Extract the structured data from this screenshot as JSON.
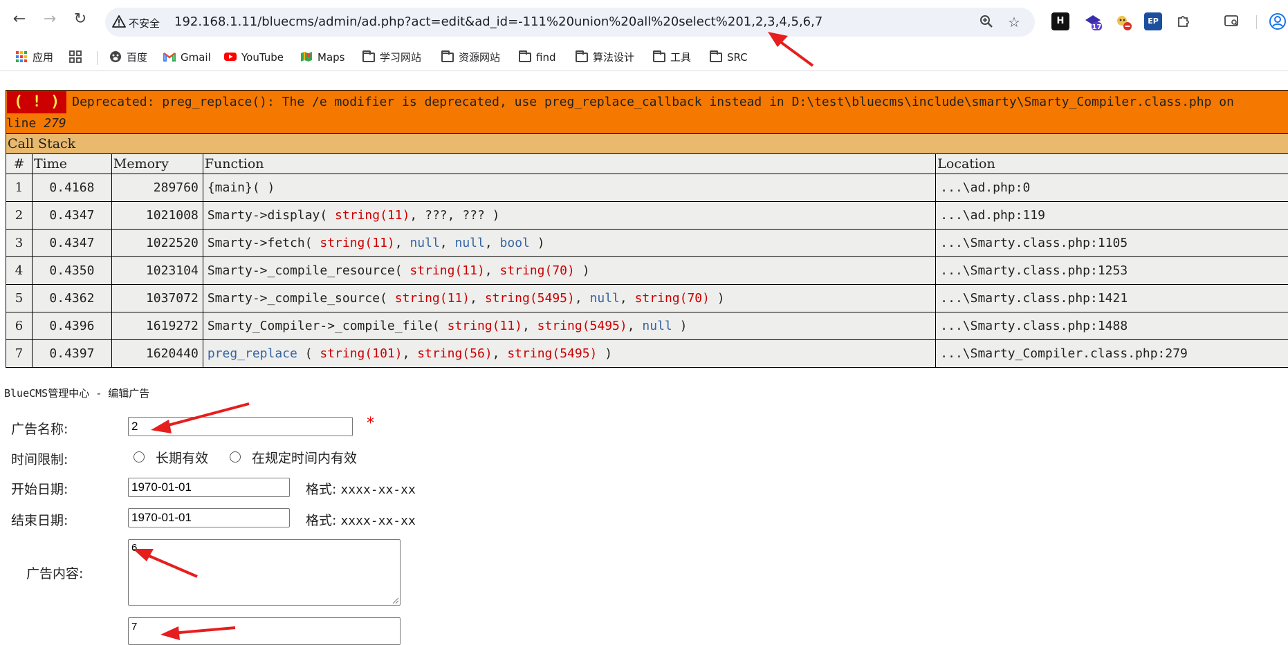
{
  "browser": {
    "security_label": "不安全",
    "url": "192.168.1.11/bluecms/admin/ad.php?act=edit&ad_id=-111%20union%20all%20select%201,2,3,4,5,6,7",
    "extensions": [
      {
        "name": "H",
        "color": "#111111"
      },
      {
        "name": "17",
        "color": "#5b3fd1"
      }
    ],
    "bookmarks": [
      {
        "label": "应用",
        "icon": "apps-grid-icon"
      },
      {
        "label": "百度",
        "icon": "baidu-icon"
      },
      {
        "label": "Gmail",
        "icon": "gmail-icon"
      },
      {
        "label": "YouTube",
        "icon": "youtube-icon"
      },
      {
        "label": "Maps",
        "icon": "maps-icon"
      },
      {
        "label": "学习网站",
        "icon": "folder-icon"
      },
      {
        "label": "资源网站",
        "icon": "folder-icon"
      },
      {
        "label": "find",
        "icon": "folder-icon"
      },
      {
        "label": "算法设计",
        "icon": "folder-icon"
      },
      {
        "label": "工具",
        "icon": "folder-icon"
      },
      {
        "label": "SRC",
        "icon": "folder-icon"
      }
    ]
  },
  "error": {
    "badge": "( ! )",
    "message": "Deprecated: preg_replace(): The /e modifier is deprecated, use preg_replace_callback instead in D:\\test\\bluecms\\include\\smarty\\Smarty_Compiler.class.php on",
    "line_prefix": "line",
    "line_number": "279",
    "call_stack_title": "Call Stack",
    "headers": {
      "num": "#",
      "time": "Time",
      "memory": "Memory",
      "function": "Function",
      "location": "Location"
    },
    "rows": [
      {
        "num": "1",
        "time": "0.4168",
        "memory": "289760",
        "location": "...\\ad.php:0"
      },
      {
        "num": "2",
        "time": "0.4347",
        "memory": "1021008",
        "location": "...\\ad.php:119"
      },
      {
        "num": "3",
        "time": "0.4347",
        "memory": "1022520",
        "location": "...\\Smarty.class.php:1105"
      },
      {
        "num": "4",
        "time": "0.4350",
        "memory": "1023104",
        "location": "...\\Smarty.class.php:1253"
      },
      {
        "num": "5",
        "time": "0.4362",
        "memory": "1037072",
        "location": "...\\Smarty.class.php:1421"
      },
      {
        "num": "6",
        "time": "0.4396",
        "memory": "1619272",
        "location": "...\\Smarty.class.php:1488"
      },
      {
        "num": "7",
        "time": "0.4397",
        "memory": "1620440",
        "location": "...\\Smarty_Compiler.class.php:279"
      }
    ],
    "functions": {
      "r1": "{main}( )",
      "r2_name": "Smarty->display(",
      "r3_name": "Smarty->fetch(",
      "r4_name": "Smarty->_compile_resource(",
      "r5_name": "Smarty->_compile_source(",
      "r6_name": "Smarty_Compiler->_compile_file(",
      "r7_name": "preg_replace",
      "s11": "string(11)",
      "s70": "string(70)",
      "s5495": "string(5495)",
      "s101": "string(101)",
      "s56": "string(56)",
      "null": "null",
      "bool": "bool",
      "unknown": "???"
    }
  },
  "form": {
    "page_title": "BlueCMS管理中心 - 编辑广告",
    "name_label": "广告名称:",
    "name_value": "2",
    "required_mark": "*",
    "time_limit_label": "时间限制:",
    "radio_long": "长期有效",
    "radio_range": "在规定时间内有效",
    "start_label": "开始日期:",
    "start_value": "1970-01-01",
    "end_label": "结束日期:",
    "end_value": "1970-01-01",
    "format_label": "格式:",
    "format_value": "xxxx-xx-xx",
    "content_label": "广告内容:",
    "content_value": "6",
    "extra_value": "7"
  }
}
